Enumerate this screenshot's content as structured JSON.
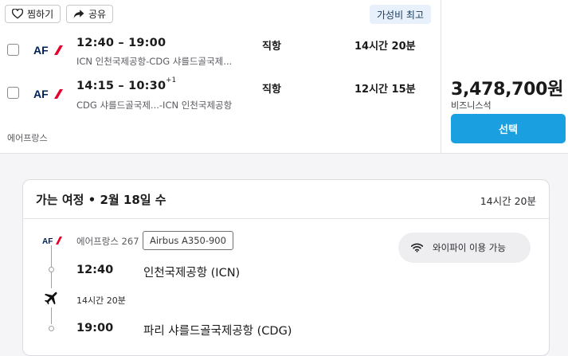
{
  "actions": {
    "save_label": "찜하기",
    "share_label": "공유"
  },
  "badge": "가성비 최고",
  "legs": [
    {
      "times": "12:40 – 19:00",
      "plus_day": "",
      "route": "ICN 인천국제공항-CDG 샤를드골국제...",
      "stops": "직항",
      "duration": "14시간 20분"
    },
    {
      "times": "14:15 – 10:30",
      "plus_day": "+1",
      "route": "CDG 샤를드골국제...-ICN 인천국제공항",
      "stops": "직항",
      "duration": "12시간 15분"
    }
  ],
  "airline": "에어프랑스",
  "price": "3,478,700원",
  "cabin": "비즈니스석",
  "select_label": "선택",
  "detail": {
    "title": "가는 여정 • 2월 18일 수",
    "duration": "14시간 20분",
    "flight_number": "에어프랑스 267",
    "aircraft": "Airbus A350-900",
    "amenity": "와이파이 이용 가능",
    "departure": {
      "time": "12:40",
      "airport": "인천국제공항 (ICN)"
    },
    "segment_duration": "14시간 20분",
    "arrival": {
      "time": "19:00",
      "airport": "파리 샤를드골국제공항 (CDG)"
    }
  },
  "colors": {
    "accent": "#1a9fe0",
    "badge_bg": "#e7f0fb",
    "af_navy": "#002157",
    "af_red": "#e4002b"
  },
  "icons": {
    "save": "heart-icon",
    "share": "share-arrow-icon",
    "wifi": "wifi-icon",
    "plane": "airplane-icon"
  }
}
